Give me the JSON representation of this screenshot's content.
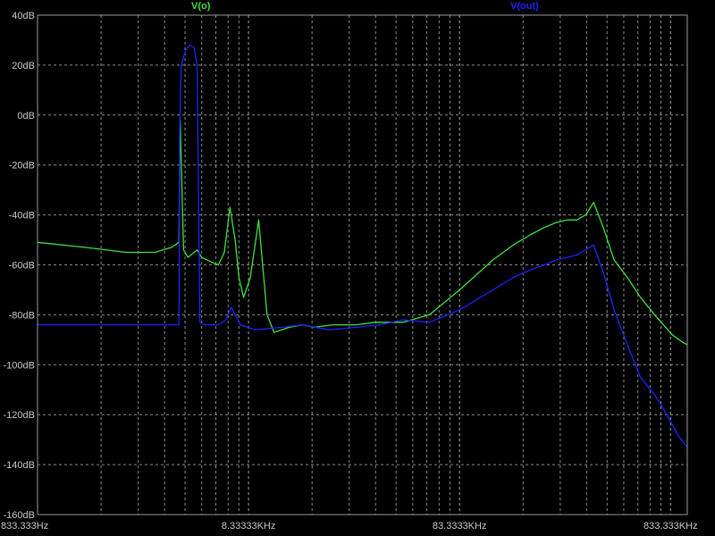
{
  "chart_data": {
    "type": "line",
    "title": "",
    "xlabel": "",
    "ylabel": "",
    "x_scale": "log",
    "x_unit": "Hz",
    "y_unit": "dB",
    "xlim": [
      833.333,
      1000000
    ],
    "ylim": [
      -160,
      40
    ],
    "grid": true,
    "y_ticks": [
      {
        "value": 40,
        "label": "40dB"
      },
      {
        "value": 20,
        "label": "20dB"
      },
      {
        "value": 0,
        "label": "0dB"
      },
      {
        "value": -20,
        "label": "-20dB"
      },
      {
        "value": -40,
        "label": "-40dB"
      },
      {
        "value": -60,
        "label": "-60dB"
      },
      {
        "value": -80,
        "label": "-80dB"
      },
      {
        "value": -100,
        "label": "-100dB"
      },
      {
        "value": -120,
        "label": "-120dB"
      },
      {
        "value": -140,
        "label": "-140dB"
      },
      {
        "value": -160,
        "label": "-160dB"
      }
    ],
    "x_ticks": [
      {
        "value": 833.333,
        "label": "833.333Hz"
      },
      {
        "value": 8333.33,
        "label": "8.33333KHz"
      },
      {
        "value": 83333.3,
        "label": "83.3333KHz"
      },
      {
        "value": 833333,
        "label": "833.333KHz"
      }
    ],
    "series": [
      {
        "name": "V(o)",
        "color": "#3fe23f",
        "x": [
          833.333,
          1400,
          2200,
          3000,
          3600,
          3900,
          3950,
          4100,
          4300,
          4600,
          4750,
          5000,
          5600,
          6000,
          6400,
          6800,
          7200,
          7500,
          7900,
          8500,
          9300,
          10200,
          11000,
          13000,
          15000,
          17000,
          21000,
          27000,
          33000,
          45000,
          60000,
          83333,
          120000,
          150000,
          180000,
          210000,
          240000,
          270000,
          300000,
          330000,
          360000,
          400000,
          450000,
          520000,
          600000,
          700000,
          850000,
          950000,
          1000000
        ],
        "y": [
          -51,
          -53,
          -55,
          -55,
          -53,
          -51,
          -2,
          -54,
          -57,
          -55,
          -54,
          -57,
          -59,
          -60,
          -55,
          -37,
          -50,
          -65,
          -73,
          -65,
          -42,
          -80,
          -87,
          -85,
          -84,
          -85,
          -84,
          -84,
          -83,
          -83,
          -80,
          -70,
          -58,
          -52,
          -48,
          -45,
          -43,
          -42,
          -42,
          -40,
          -35,
          -45,
          -58,
          -65,
          -73,
          -80,
          -88,
          -91,
          -92
        ]
      },
      {
        "name": "V(out)",
        "color": "#1e22ff",
        "x": [
          833.333,
          1400,
          2200,
          3000,
          3600,
          3900,
          3930,
          3950,
          4000,
          4200,
          4400,
          4600,
          4750,
          4900,
          5200,
          5600,
          6000,
          6500,
          6900,
          7200,
          7600,
          9000,
          12000,
          15000,
          20000,
          27000,
          35000,
          45000,
          60000,
          83333,
          120000,
          150000,
          180000,
          210000,
          240000,
          270000,
          300000,
          330000,
          360000,
          400000,
          450000,
          520000,
          600000,
          700000,
          800000,
          900000,
          1000000
        ],
        "y": [
          -84,
          -84,
          -84,
          -84,
          -84,
          -84,
          -10,
          5,
          20,
          26,
          28,
          27,
          20,
          -83,
          -84,
          -84,
          -84,
          -82,
          -77,
          -80,
          -84,
          -86,
          -85,
          -84,
          -86,
          -85,
          -84,
          -82,
          -83,
          -78,
          -70,
          -65,
          -62,
          -60,
          -58,
          -57,
          -56,
          -54,
          -52,
          -63,
          -78,
          -92,
          -105,
          -112,
          -120,
          -128,
          -133
        ]
      }
    ]
  }
}
